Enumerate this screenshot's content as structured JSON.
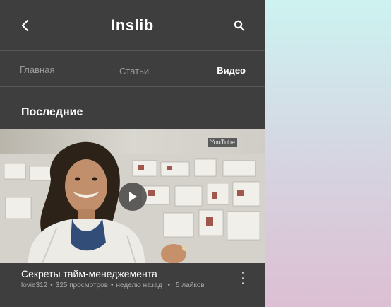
{
  "header": {
    "title": "Inslib",
    "back_icon": "chevron-left-icon",
    "search_icon": "search-icon"
  },
  "tabs": [
    {
      "label": "Главная",
      "active": false
    },
    {
      "label": "Статьи",
      "active": false
    },
    {
      "label": "Видео",
      "active": true
    }
  ],
  "section": {
    "title": "Последние"
  },
  "video": {
    "source_badge": "YouTube",
    "play_icon": "play-icon",
    "title": "Секреты тайм-менеджемента",
    "author": "lovie312",
    "views": "325 просмотров",
    "posted": "неделю назад",
    "likes": "5 лайков",
    "more_icon": "more-vertical-icon"
  },
  "colors": {
    "app_background": "#3e3e3e",
    "text_primary": "#ffffff",
    "text_muted": "#9a9a9a",
    "gradient_top": "#cdf3f1",
    "gradient_bottom": "#dcbfd2"
  }
}
